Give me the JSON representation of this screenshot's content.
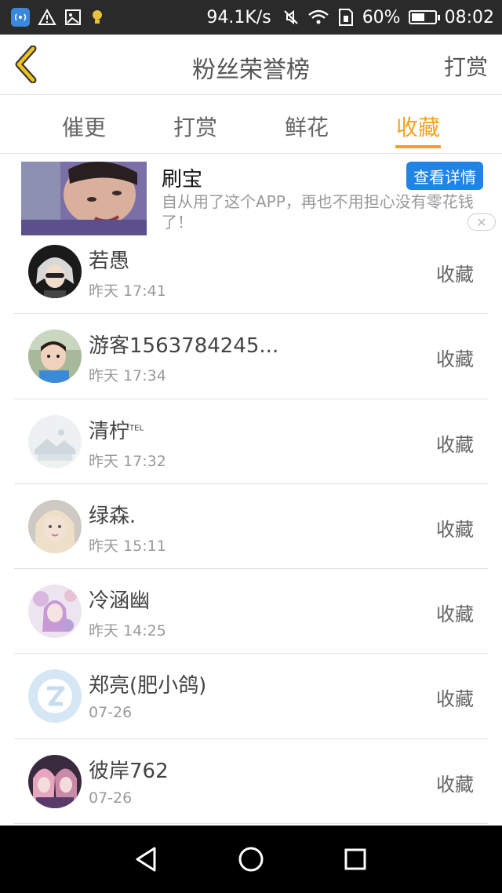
{
  "status_bar": {
    "speed": "94.1K/s",
    "battery_percent": "60%",
    "battery_level": 0.6,
    "time": "08:02"
  },
  "header": {
    "title": "粉丝荣誉榜",
    "right_action": "打赏"
  },
  "tabs": [
    {
      "label": "催更",
      "active": false
    },
    {
      "label": "打赏",
      "active": false
    },
    {
      "label": "鲜花",
      "active": false
    },
    {
      "label": "收藏",
      "active": true
    }
  ],
  "ad": {
    "title": "刷宝",
    "cta": "查看详情",
    "description": "自从用了这个APP，再也不用担心没有零花钱了！"
  },
  "fans": [
    {
      "name": "若愚",
      "time": "昨天 17:41",
      "action": "收藏"
    },
    {
      "name": "游客1563784245...",
      "time": "昨天 17:34",
      "action": "收藏"
    },
    {
      "name": "清柠",
      "time": "昨天 17:32",
      "action": "收藏"
    },
    {
      "name": "绿森.",
      "time": "昨天 15:11",
      "action": "收藏"
    },
    {
      "name": "冷涵幽",
      "time": "昨天 14:25",
      "action": "收藏"
    },
    {
      "name": "郑亮(肥小鸽)",
      "time": "07-26",
      "action": "收藏"
    },
    {
      "name": "彼岸762",
      "time": "07-26",
      "action": "收藏"
    }
  ],
  "colors": {
    "accent": "#f5a31a",
    "ad_button": "#1f84e6"
  }
}
